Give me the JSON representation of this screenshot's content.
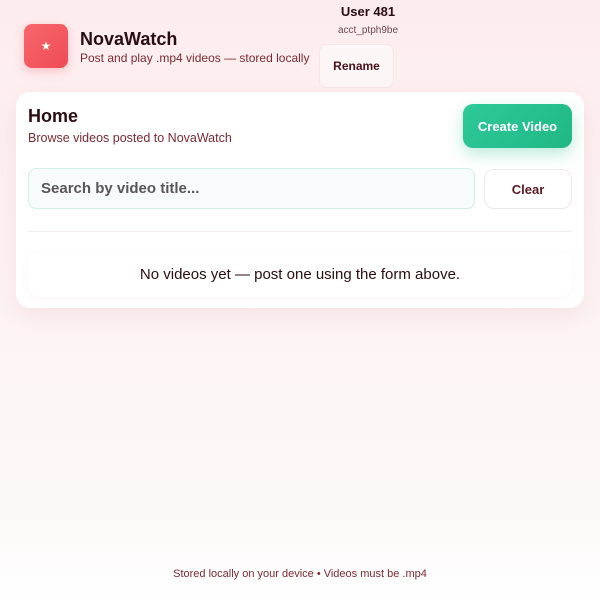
{
  "header": {
    "logo_glyph": "★",
    "app_title": "NovaWatch",
    "app_subtitle": "Post and play .mp4 videos — stored locally"
  },
  "user": {
    "name": "User 481",
    "id": "acct_ptph9be",
    "rename_label": "Rename"
  },
  "home": {
    "title": "Home",
    "subtitle": "Browse videos posted to NovaWatch",
    "create_label": "Create Video",
    "search_placeholder": "Search by video title...",
    "search_value": "",
    "clear_label": "Clear",
    "empty_message": "No videos yet — post one using the form above."
  },
  "footer": {
    "text": "Stored locally on your device • Videos must be .mp4"
  },
  "colors": {
    "brand_red": "#ef4b55",
    "accent_green": "#1fb884",
    "text_maroon": "#7a2a32"
  },
  "icons": {
    "logo": "star-icon"
  }
}
